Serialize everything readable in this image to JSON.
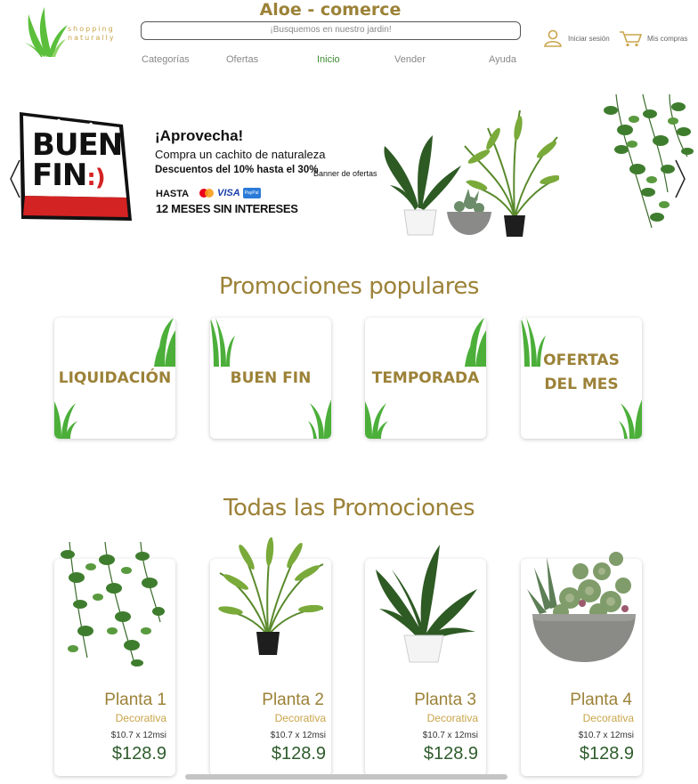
{
  "header": {
    "site_title": "Aloe - comerce",
    "logo_text_line1": "shopping",
    "logo_text_line2": "naturally",
    "search_placeholder": "¡Busquemos en nuestro jardin!",
    "login_label": "Iniciar sesión",
    "purchases_label": "Mis compras"
  },
  "nav": [
    "Categorías",
    "Ofertas",
    "Inicio",
    "Vender",
    "Ayuda"
  ],
  "nav_active": "Inicio",
  "banner": {
    "sign_line1": "BUEN",
    "sign_line2": "FIN",
    "sign_smile": ":)",
    "title": "¡Aprovecha!",
    "subtitle": "Compra un cachito de naturaleza",
    "discount": "Descuentos del 10% hasta el 30%",
    "hasta": "HASTA",
    "msi": "12 MESES SIN INTERESES",
    "visa": "VISA",
    "paypal": "PayPal",
    "alt_text": "Banner de ofertas"
  },
  "popular": {
    "title": "Promociones populares",
    "cards": [
      {
        "label_line1": "LIQUIDACIÓN",
        "label_line2": ""
      },
      {
        "label_line1": "BUEN FIN",
        "label_line2": ""
      },
      {
        "label_line1": "TEMPORADA",
        "label_line2": ""
      },
      {
        "label_line1": "OFERTAS",
        "label_line2": "DEL MES"
      }
    ]
  },
  "all": {
    "title": "Todas las Promociones",
    "products": [
      {
        "name": "Planta 1",
        "category": "Decorativa",
        "msi": "$10.7 x 12msi",
        "price": "$128.9"
      },
      {
        "name": "Planta 2",
        "category": "Decorativa",
        "msi": "$10.7 x 12msi",
        "price": "$128.9"
      },
      {
        "name": "Planta 3",
        "category": "Decorativa",
        "msi": "$10.7 x 12msi",
        "price": "$128.9"
      },
      {
        "name": "Planta 4",
        "category": "Decorativa",
        "msi": "$10.7 x 12msi",
        "price": "$128.9"
      }
    ]
  },
  "colors": {
    "accent_gold": "#9c8238",
    "nav_active": "#3d8b30",
    "price_green": "#2e5c2c",
    "grass_green": "#4caf3a"
  },
  "icons": [
    "aloe-logo-icon",
    "user-icon",
    "cart-icon",
    "chevron-left-icon",
    "chevron-right-icon",
    "mastercard-icon"
  ]
}
